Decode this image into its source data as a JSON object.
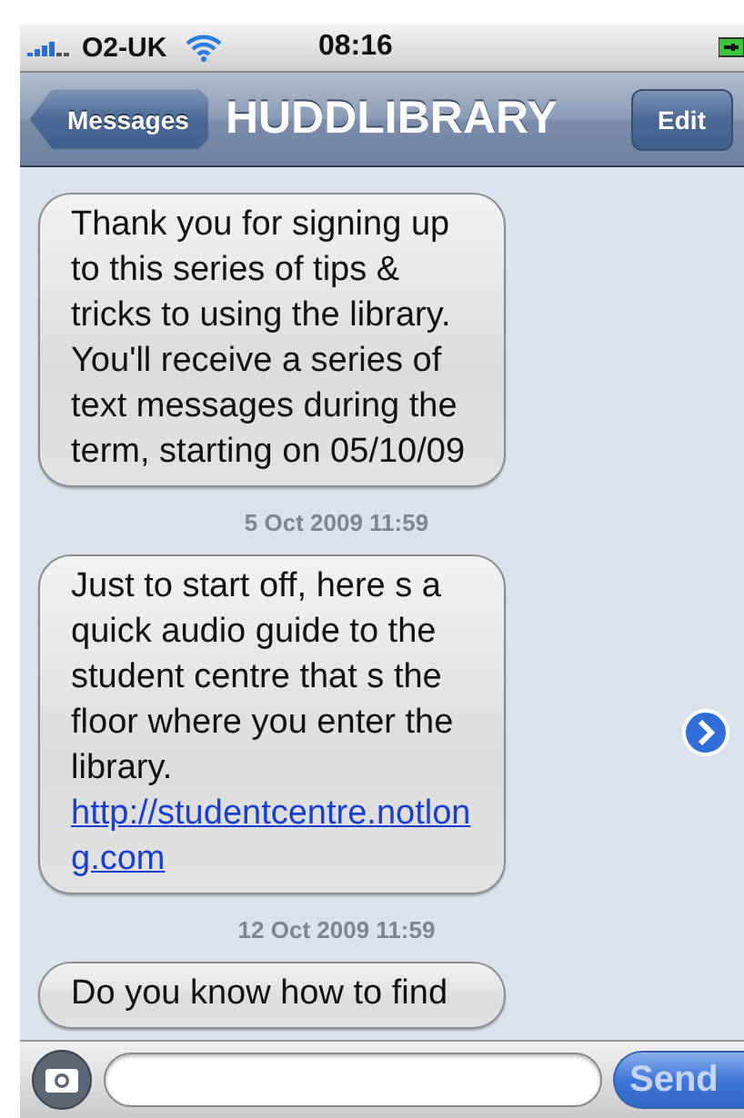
{
  "status_bar": {
    "carrier": "O2-UK",
    "time": "08:16"
  },
  "nav_bar": {
    "back": "Messages",
    "title": "HUDDLIBRARY",
    "action": "Edit"
  },
  "messages": [
    {
      "kind": "bubble",
      "text": "Thank you for signing up to this series of tips & tricks to using the library. You'll receive a series of text messages during the term, starting on 05/10/09"
    },
    {
      "kind": "timestamp",
      "text": "5 Oct 2009 11:59"
    },
    {
      "kind": "bubble",
      "text": "Just to start off, here s a quick audio guide to the student centre that s the floor where you enter the library.",
      "link": "http://studentcentre.notlong.com",
      "disclosure": true
    },
    {
      "kind": "timestamp",
      "text": "12 Oct 2009 11:59"
    },
    {
      "kind": "bubble",
      "text": "Do you know how to find"
    }
  ],
  "compose": {
    "send": "Send"
  }
}
